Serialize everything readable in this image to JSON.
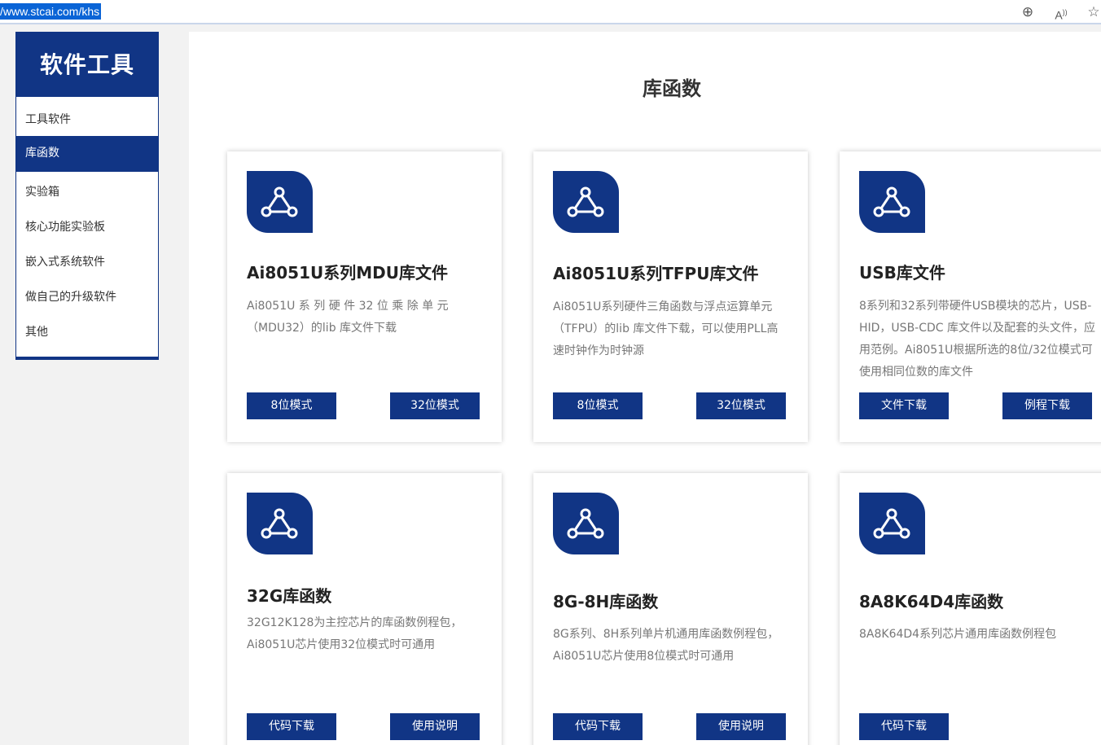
{
  "address_bar": {
    "url": "/www.stcai.com/khs"
  },
  "sidebar": {
    "title": "软件工具",
    "items": [
      {
        "label": "工具软件"
      },
      {
        "label": "库函数"
      },
      {
        "label": "实验箱"
      },
      {
        "label": "核心功能实验板"
      },
      {
        "label": "嵌入式系统软件"
      },
      {
        "label": "做自己的升级软件"
      },
      {
        "label": "其他"
      }
    ]
  },
  "main": {
    "title": "库函数",
    "cards": [
      {
        "title": "Ai8051U系列MDU库文件",
        "desc": "Ai8051U 系 列 硬 件 32 位 乘 除 单 元（MDU32）的lib 库文件下载",
        "btn1": "8位模式",
        "btn2": "32位模式"
      },
      {
        "title": "Ai8051U系列TFPU库文件",
        "desc": "Ai8051U系列硬件三角函数与浮点运算单元（TFPU）的lib 库文件下载，可以使用PLL高速时钟作为时钟源",
        "btn1": "8位模式",
        "btn2": "32位模式"
      },
      {
        "title": "USB库文件",
        "desc": "8系列和32系列带硬件USB模块的芯片，USB-HID，USB-CDC 库文件以及配套的头文件，应用范例。Ai8051U根据所选的8位/32位模式可使用相同位数的库文件",
        "btn1": "文件下载",
        "btn2": "例程下载"
      },
      {
        "title": "32G库函数",
        "desc": "32G12K128为主控芯片的库函数例程包，Ai8051U芯片使用32位模式时可通用",
        "btn1": "代码下载",
        "btn2": "使用说明"
      },
      {
        "title": "8G-8H库函数",
        "desc": "8G系列、8H系列单片机通用库函数例程包，Ai8051U芯片使用8位模式时可通用",
        "btn1": "代码下载",
        "btn2": "使用说明"
      },
      {
        "title": "8A8K64D4库函数",
        "desc": "8A8K64D4系列芯片通用库函数例程包",
        "btn1": "代码下载"
      }
    ]
  },
  "icons": {
    "card_logo": "network-nodes-icon",
    "zoom": "zoom-in-icon",
    "read_aloud": "read-aloud-icon",
    "favorite": "star-icon"
  },
  "colors": {
    "brand": "#113585"
  }
}
